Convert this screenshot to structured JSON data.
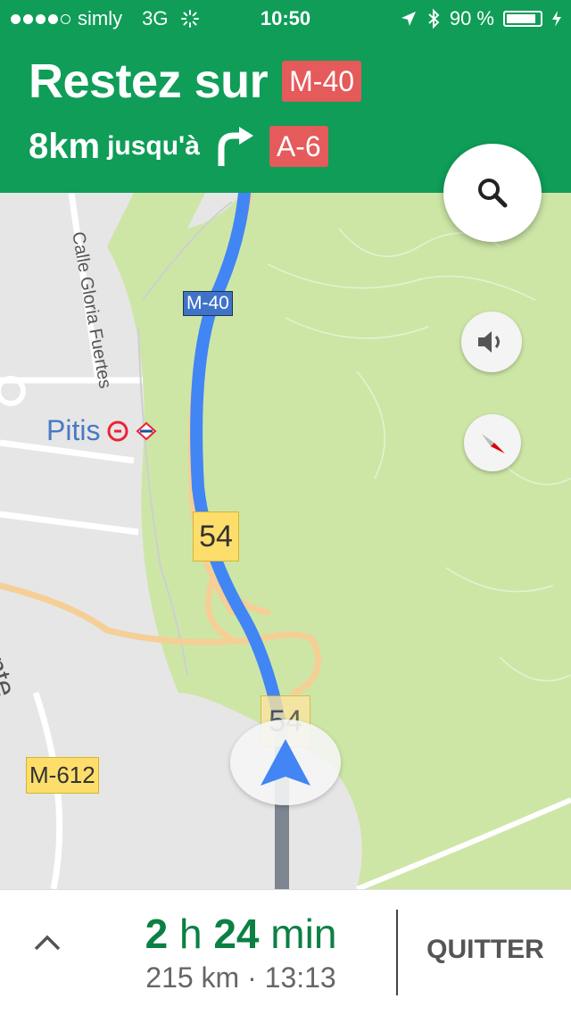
{
  "status_bar": {
    "carrier": "simly",
    "network": "3G",
    "time": "10:50",
    "battery": "90 %",
    "battery_level": 0.9
  },
  "instruction": {
    "verb": "Restez sur",
    "road": "M-40",
    "distance": "8km",
    "until": "jusqu'à",
    "next_road": "A-6",
    "next_turn": "turn-right-icon"
  },
  "map": {
    "street_name": "Calle Gloria Fuertes",
    "station_name": "Pitis",
    "partial_street": "Monte",
    "road_shield_m40": "M-40",
    "road_shield_54_a": "54",
    "road_shield_54_b": "54",
    "road_shield_m612": "M-612"
  },
  "controls": {
    "search_icon": "search-icon",
    "sound_icon": "speaker-icon",
    "compass_icon": "compass-icon"
  },
  "trip": {
    "hours": "2",
    "h_unit": "h",
    "minutes": "24",
    "min_unit": "min",
    "distance": "215 km",
    "separator": "·",
    "arrival": "13:13",
    "quit_label": "QUITTER"
  },
  "colors": {
    "header_green": "#0f9d58",
    "route_blue": "#4285f4",
    "shield_red": "#e55a5a",
    "eta_green": "#0b8043",
    "park_green": "#cde6a6"
  }
}
